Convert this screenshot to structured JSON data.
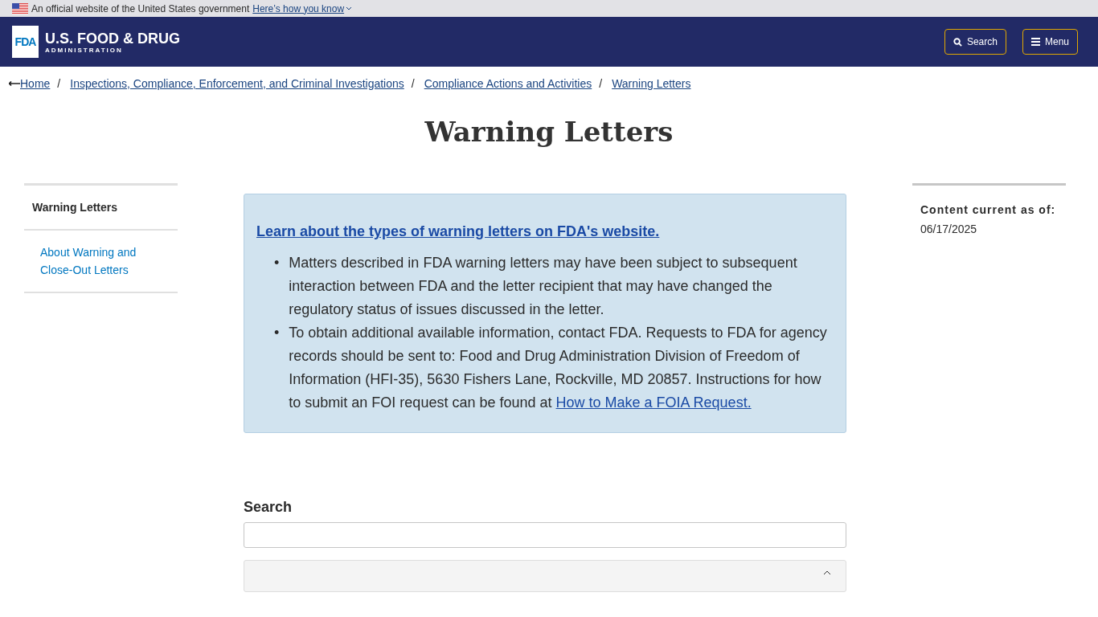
{
  "gov_banner": {
    "text": "An official website of the United States government",
    "link": "Here’s how you know"
  },
  "header": {
    "logo_mark": "FDA",
    "logo_title": "U.S. FOOD & DRUG",
    "logo_subtitle": "ADMINISTRATION",
    "buttons": [
      {
        "kind": "search",
        "label": "Search"
      },
      {
        "kind": "menu",
        "label": "Menu"
      }
    ]
  },
  "breadcrumb_separator": "/",
  "breadcrumbs": [
    "Home",
    "Inspections, Compliance, Enforcement, and Criminal Investigations",
    "Compliance Actions and Activities",
    "Warning Letters"
  ],
  "page_title": "Warning Letters",
  "sidebar": {
    "items": [
      {
        "label": "Warning Letters",
        "selected": true
      },
      {
        "label": "About Warning and Close-Out Letters",
        "selected": false
      }
    ]
  },
  "notice": {
    "link": "Learn about the types of warning letters on FDA's website.",
    "bullets": [
      {
        "marker": "•",
        "text": "Matters described in FDA warning letters may have been subject to subsequent interaction between FDA and the letter recipient that may have changed the regulatory status of issues discussed in the letter."
      },
      {
        "marker": "•",
        "text": "To obtain additional available information, contact FDA. Requests to FDA for agency records should be sent to: Food and Drug Administration Division of Freedom of Information (HFI-35), 5630 Fishers Lane, Rockville, MD 20857. Instructions for how to submit an FOI request can be found at",
        "link": "How to Make a FOIA Request."
      }
    ]
  },
  "search": {
    "label": "Search"
  },
  "content_info": {
    "label": "Content current as of:",
    "date": "06/17/2025"
  }
}
